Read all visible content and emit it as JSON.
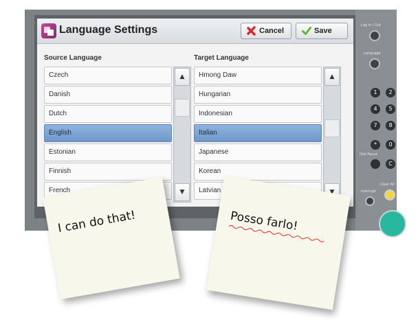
{
  "window": {
    "title": "Language Settings",
    "cancel_label": "Cancel",
    "save_label": "Save"
  },
  "source": {
    "label": "Source Language",
    "items": [
      "Czech",
      "Danish",
      "Dutch",
      "English",
      "Estonian",
      "Finnish",
      "French"
    ],
    "selected": "English"
  },
  "target": {
    "label": "Target Language",
    "items": [
      "Hmong Daw",
      "Hungarian",
      "Indonesian",
      "Italian",
      "Japanese",
      "Korean",
      "Latvian"
    ],
    "selected": "Italian"
  },
  "scroll": {
    "up_glyph": "▲",
    "down_glyph": "▼"
  },
  "hardware": {
    "top_label": "Log In / Out",
    "language_label": "Language",
    "interrupt_label": "Interrupt",
    "clear_label": "Clear All",
    "dial_pause_label": "Dial Pause",
    "keypad": [
      "1",
      "4",
      "7",
      "*",
      "2",
      "5",
      "8",
      "0",
      "C"
    ]
  },
  "notes": {
    "english": "I can do that!",
    "italian": "Posso farlo!"
  },
  "colors": {
    "selection": "#7aa2d2",
    "note_paper": "#f7f7ec",
    "device": "#7d8286",
    "start_button": "#28b8a0"
  }
}
